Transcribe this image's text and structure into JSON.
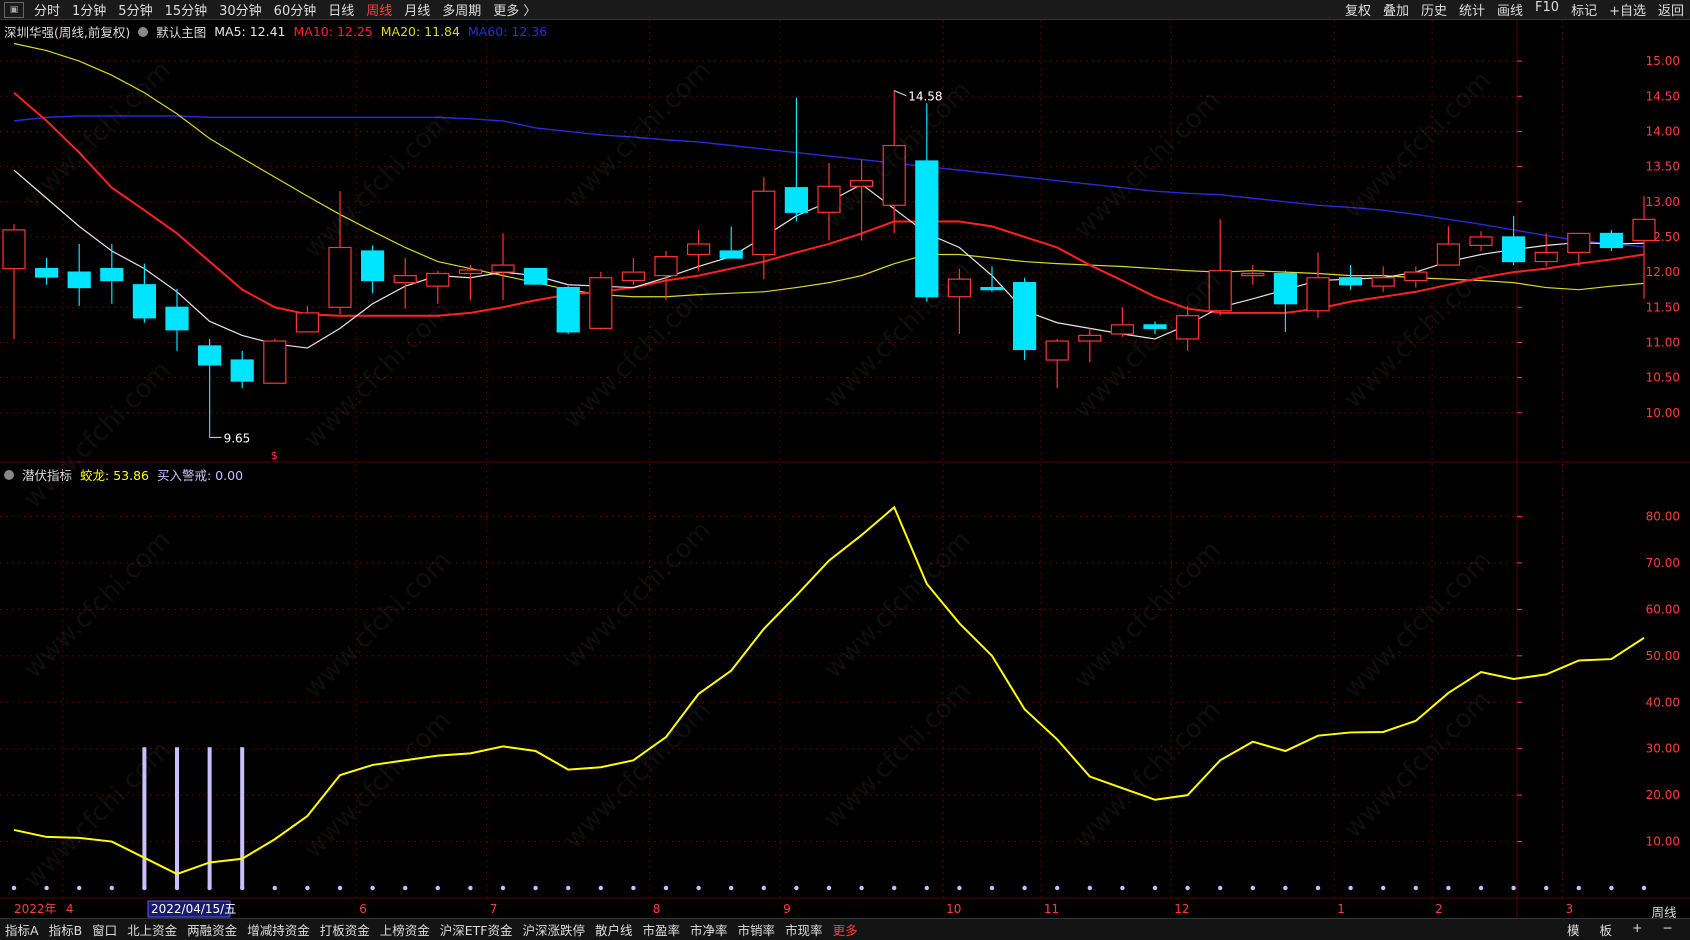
{
  "colors": {
    "up": "#ff3333",
    "down": "#00e5ff",
    "ma5": "#e6e6e6",
    "ma10": "#ff2020",
    "ma20": "#d8d82a",
    "ma60": "#2a2ad8",
    "osc": "#ffff00",
    "grid": "#5a0000",
    "alert": "#c8c0ff",
    "axis": "#ff3c3c"
  },
  "topbar": {
    "left": [
      "分时",
      "1分钟",
      "5分钟",
      "15分钟",
      "30分钟",
      "60分钟",
      "日线",
      "周线",
      "月线",
      "多周期",
      "更多 〉"
    ],
    "active": "周线",
    "right": [
      "复权",
      "叠加",
      "历史",
      "统计",
      "画线",
      "F10",
      "标记",
      "+自选",
      "返回"
    ]
  },
  "legend_main": {
    "name": "深圳华强(周线,前复权)",
    "main": "默认主图",
    "ma5_label": "MA5: 12.41",
    "ma10_label": "MA10: 12.25",
    "ma20_label": "MA20: 11.84",
    "ma60_label": "MA60: 12.36"
  },
  "legend_sub": {
    "name": "潜伏指标",
    "val1_label": "蛟龙: 53.86",
    "val2_label": "买入警戒: 0.00"
  },
  "axis_date": {
    "year": "2022年",
    "cursor": "2022/04/15/五"
  },
  "bottom_tabs": [
    "指标A",
    "指标B",
    "窗口",
    "北上资金",
    "两融资金",
    "增减持资金",
    "打板资金",
    "上榜资金",
    "沪深ETF资金",
    "沪深涨跌停",
    "散户线",
    "市盈率",
    "市净率",
    "市销率",
    "市现率",
    "更多"
  ],
  "bottom_active": "更多",
  "bottom_right": [
    "模",
    "板",
    "+",
    "−"
  ],
  "period": "周线",
  "chart_data": {
    "type": "candlestick",
    "price_axis": {
      "ylim": [
        9.3,
        15.3
      ],
      "ticks": [
        "15.00",
        "14.50",
        "14.00",
        "13.50",
        "13.00",
        "12.50",
        "12.00",
        "11.50",
        "11.00",
        "10.50",
        "10.00"
      ]
    },
    "sub_axis": {
      "ylim": [
        0,
        87
      ],
      "ticks": [
        "80.00",
        "70.00",
        "60.00",
        "50.00",
        "40.00",
        "30.00",
        "20.00",
        "10.00"
      ]
    },
    "annotations": {
      "high": "14.58",
      "low": "9.65",
      "marker": "$"
    },
    "month_labels": [
      {
        "i": 2,
        "label": "4"
      },
      {
        "i": 11,
        "label": "6"
      },
      {
        "i": 15,
        "label": "7"
      },
      {
        "i": 20,
        "label": "8"
      },
      {
        "i": 24,
        "label": "9"
      },
      {
        "i": 29,
        "label": "10"
      },
      {
        "i": 32,
        "label": "11"
      },
      {
        "i": 36,
        "label": "12"
      },
      {
        "i": 41,
        "label": "1"
      },
      {
        "i": 44,
        "label": "2"
      },
      {
        "i": 48,
        "label": "3"
      }
    ],
    "candles": [
      {
        "o": 12.05,
        "h": 12.68,
        "l": 11.05,
        "c": 12.6
      },
      {
        "o": 12.05,
        "h": 12.2,
        "l": 11.82,
        "c": 11.93
      },
      {
        "o": 12.0,
        "h": 12.4,
        "l": 11.52,
        "c": 11.78
      },
      {
        "o": 12.05,
        "h": 12.4,
        "l": 11.55,
        "c": 11.88
      },
      {
        "o": 11.82,
        "h": 12.12,
        "l": 11.28,
        "c": 11.35
      },
      {
        "o": 11.5,
        "h": 11.76,
        "l": 10.88,
        "c": 11.18
      },
      {
        "o": 10.95,
        "h": 11.05,
        "l": 9.65,
        "c": 10.68
      },
      {
        "o": 10.75,
        "h": 10.88,
        "l": 10.35,
        "c": 10.45
      },
      {
        "o": 10.42,
        "h": 11.05,
        "l": 10.42,
        "c": 11.02
      },
      {
        "o": 11.15,
        "h": 11.52,
        "l": 11.15,
        "c": 11.42
      },
      {
        "o": 11.5,
        "h": 13.15,
        "l": 11.4,
        "c": 12.35
      },
      {
        "o": 12.3,
        "h": 12.38,
        "l": 11.7,
        "c": 11.88
      },
      {
        "o": 11.85,
        "h": 12.2,
        "l": 11.48,
        "c": 11.95
      },
      {
        "o": 11.8,
        "h": 12.02,
        "l": 11.55,
        "c": 11.98
      },
      {
        "o": 11.98,
        "h": 12.1,
        "l": 11.6,
        "c": 12.03
      },
      {
        "o": 12.0,
        "h": 12.55,
        "l": 11.6,
        "c": 12.1
      },
      {
        "o": 12.05,
        "h": 12.05,
        "l": 11.82,
        "c": 11.83
      },
      {
        "o": 11.78,
        "h": 11.8,
        "l": 11.12,
        "c": 11.15
      },
      {
        "o": 11.2,
        "h": 12.0,
        "l": 11.18,
        "c": 11.92
      },
      {
        "o": 11.88,
        "h": 12.2,
        "l": 11.82,
        "c": 12.0
      },
      {
        "o": 11.95,
        "h": 12.3,
        "l": 11.6,
        "c": 12.22
      },
      {
        "o": 12.25,
        "h": 12.6,
        "l": 12.02,
        "c": 12.4
      },
      {
        "o": 12.3,
        "h": 12.65,
        "l": 12.25,
        "c": 12.2
      },
      {
        "o": 12.25,
        "h": 13.35,
        "l": 11.9,
        "c": 13.15
      },
      {
        "o": 13.2,
        "h": 14.48,
        "l": 12.72,
        "c": 12.85
      },
      {
        "o": 12.85,
        "h": 13.55,
        "l": 12.45,
        "c": 13.22
      },
      {
        "o": 13.22,
        "h": 13.6,
        "l": 12.45,
        "c": 13.3
      },
      {
        "o": 12.95,
        "h": 14.58,
        "l": 12.55,
        "c": 13.8
      },
      {
        "o": 13.58,
        "h": 14.4,
        "l": 11.58,
        "c": 11.65
      },
      {
        "o": 11.65,
        "h": 12.05,
        "l": 11.12,
        "c": 11.9
      },
      {
        "o": 11.78,
        "h": 12.08,
        "l": 11.72,
        "c": 11.75
      },
      {
        "o": 11.85,
        "h": 11.92,
        "l": 10.75,
        "c": 10.9
      },
      {
        "o": 10.75,
        "h": 11.05,
        "l": 10.35,
        "c": 11.02
      },
      {
        "o": 11.02,
        "h": 11.2,
        "l": 10.72,
        "c": 11.1
      },
      {
        "o": 11.12,
        "h": 11.5,
        "l": 11.08,
        "c": 11.25
      },
      {
        "o": 11.25,
        "h": 11.3,
        "l": 11.12,
        "c": 11.2
      },
      {
        "o": 11.05,
        "h": 11.52,
        "l": 10.88,
        "c": 11.38
      },
      {
        "o": 11.45,
        "h": 12.75,
        "l": 11.38,
        "c": 12.02
      },
      {
        "o": 11.95,
        "h": 12.1,
        "l": 11.82,
        "c": 11.98
      },
      {
        "o": 11.98,
        "h": 12.02,
        "l": 11.15,
        "c": 11.55
      },
      {
        "o": 11.45,
        "h": 12.28,
        "l": 11.35,
        "c": 11.92
      },
      {
        "o": 11.92,
        "h": 12.1,
        "l": 11.75,
        "c": 11.82
      },
      {
        "o": 11.8,
        "h": 12.08,
        "l": 11.72,
        "c": 11.92
      },
      {
        "o": 11.88,
        "h": 12.08,
        "l": 11.78,
        "c": 12.0
      },
      {
        "o": 12.1,
        "h": 12.65,
        "l": 12.1,
        "c": 12.4
      },
      {
        "o": 12.38,
        "h": 12.58,
        "l": 12.3,
        "c": 12.5
      },
      {
        "o": 12.5,
        "h": 12.8,
        "l": 12.1,
        "c": 12.15
      },
      {
        "o": 12.15,
        "h": 12.55,
        "l": 12.08,
        "c": 12.28
      },
      {
        "o": 12.28,
        "h": 12.55,
        "l": 12.08,
        "c": 12.55
      },
      {
        "o": 12.55,
        "h": 12.6,
        "l": 12.3,
        "c": 12.35
      },
      {
        "o": 12.45,
        "h": 13.08,
        "l": 11.62,
        "c": 12.75
      }
    ],
    "ma5": [
      13.45,
      13.05,
      12.65,
      12.3,
      12.05,
      11.72,
      11.3,
      11.1,
      10.98,
      10.92,
      11.2,
      11.55,
      11.8,
      11.95,
      11.92,
      12.0,
      11.95,
      11.82,
      11.8,
      11.78,
      11.92,
      12.08,
      12.22,
      12.5,
      12.8,
      13.0,
      13.25,
      12.9,
      12.55,
      12.35,
      11.95,
      11.45,
      11.28,
      11.2,
      11.12,
      11.05,
      11.25,
      11.5,
      11.62,
      11.75,
      11.88,
      11.9,
      11.92,
      12.0,
      12.15,
      12.25,
      12.32,
      12.38,
      12.42,
      12.4,
      12.41
    ],
    "ma10": [
      14.55,
      14.15,
      13.7,
      13.2,
      12.88,
      12.55,
      12.15,
      11.75,
      11.5,
      11.4,
      11.38,
      11.38,
      11.38,
      11.38,
      11.42,
      11.5,
      11.6,
      11.68,
      11.72,
      11.78,
      11.88,
      11.95,
      12.05,
      12.15,
      12.28,
      12.4,
      12.55,
      12.72,
      12.72,
      12.72,
      12.65,
      12.5,
      12.35,
      12.1,
      11.88,
      11.65,
      11.48,
      11.42,
      11.42,
      11.42,
      11.48,
      11.58,
      11.65,
      11.72,
      11.82,
      11.92,
      12.0,
      12.05,
      12.12,
      12.18,
      12.25
    ],
    "ma20": [
      15.25,
      15.15,
      15.0,
      14.8,
      14.55,
      14.25,
      13.9,
      13.62,
      13.35,
      13.08,
      12.82,
      12.58,
      12.35,
      12.15,
      12.05,
      11.95,
      11.85,
      11.75,
      11.68,
      11.65,
      11.65,
      11.68,
      11.7,
      11.72,
      11.78,
      11.85,
      11.95,
      12.12,
      12.25,
      12.25,
      12.2,
      12.15,
      12.12,
      12.1,
      12.08,
      12.05,
      12.02,
      12.0,
      12.02,
      12.0,
      11.98,
      11.95,
      11.95,
      11.92,
      11.9,
      11.88,
      11.85,
      11.78,
      11.75,
      11.8,
      11.84
    ],
    "ma60": [
      14.15,
      14.2,
      14.22,
      14.22,
      14.22,
      14.22,
      14.2,
      14.2,
      14.2,
      14.2,
      14.2,
      14.2,
      14.2,
      14.2,
      14.18,
      14.15,
      14.05,
      14.0,
      13.95,
      13.92,
      13.88,
      13.85,
      13.8,
      13.75,
      13.7,
      13.65,
      13.6,
      13.55,
      13.5,
      13.45,
      13.4,
      13.35,
      13.3,
      13.25,
      13.2,
      13.15,
      13.12,
      13.1,
      13.05,
      13.0,
      12.95,
      12.92,
      12.88,
      12.82,
      12.75,
      12.68,
      12.6,
      12.52,
      12.45,
      12.4,
      12.36
    ],
    "osc": [
      12.5,
      11.0,
      10.8,
      10.0,
      6.5,
      3.0,
      5.5,
      6.3,
      10.5,
      15.5,
      24.3,
      26.5,
      27.5,
      28.5,
      29.0,
      30.5,
      29.5,
      25.5,
      26.0,
      27.5,
      32.5,
      41.8,
      46.8,
      55.8,
      63.0,
      70.5,
      76.0,
      82.0,
      65.5,
      57.0,
      50.0,
      38.5,
      32.0,
      24.0,
      21.5,
      19.0,
      20.0,
      27.5,
      31.5,
      29.5,
      32.8,
      33.5,
      33.6,
      36.0,
      42.0,
      46.5,
      45.0,
      46.0,
      49.0,
      49.3,
      53.86
    ],
    "alerts": [
      4,
      5,
      6,
      7
    ]
  }
}
